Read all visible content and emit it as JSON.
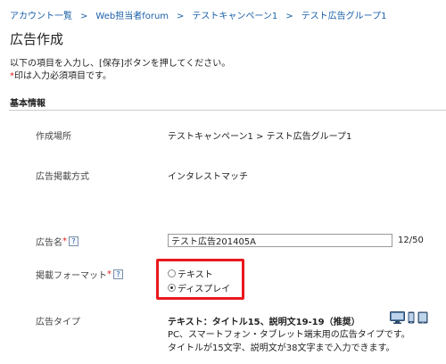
{
  "breadcrumb": {
    "items": [
      "アカウント一覧",
      "Web担当者forum",
      "テストキャンペーン1",
      "テスト広告グループ1"
    ],
    "separator": ">"
  },
  "page": {
    "title": "広告作成",
    "instruction_line1": "以下の項目を入力し、[保存]ボタンを押してください。",
    "required_mark": "*",
    "instruction_line2": "印は入力必須項目です。"
  },
  "section": {
    "title": "基本情報"
  },
  "form": {
    "location": {
      "label": "作成場所",
      "value": "テストキャンペーン1 > テスト広告グループ1"
    },
    "delivery_method": {
      "label": "広告掲載方式",
      "value": "インタレストマッチ"
    },
    "ad_name": {
      "label": "広告名",
      "required_mark": "*",
      "help_glyph": "?",
      "value": "テスト広告201405A",
      "counter": "12/50"
    },
    "format": {
      "label": "掲載フォーマット",
      "required_mark": "*",
      "help_glyph": "?",
      "options": [
        "テキスト",
        "ディスプレイ"
      ],
      "selected": "ディスプレイ"
    },
    "ad_type": {
      "label": "広告タイプ",
      "title": "テキスト：タイトル15、説明文19-19（推奨）",
      "desc_line1": "PC、スマートフォン・タブレット端末用の広告タイプです。",
      "desc_line2": "タイトルが15文字、説明文が38文字まで入力できます。",
      "device_icons": [
        "desktop-icon",
        "smartphone-icon",
        "tablet-icon"
      ]
    }
  },
  "colors": {
    "link": "#1a5fa8",
    "required": "#e02020",
    "highlight": "#e8191e"
  }
}
